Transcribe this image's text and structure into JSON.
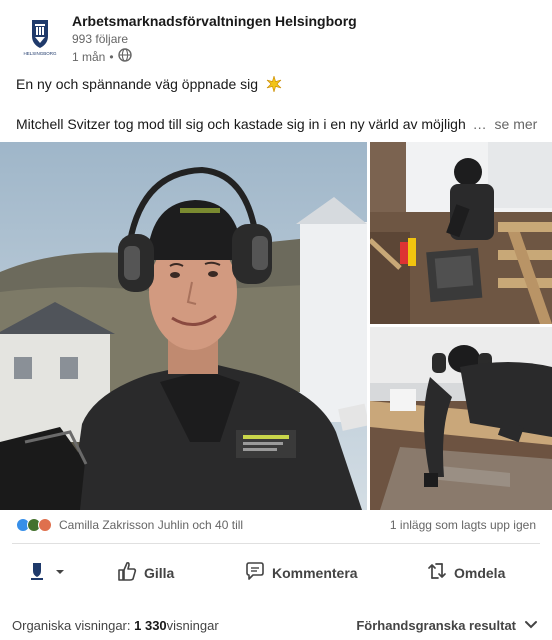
{
  "header": {
    "org_name": "Arbetsmarknadsförvaltningen Helsingborg",
    "followers": "993 följare",
    "time": "1 mån",
    "separator": "•",
    "logo_text": "HELSINGBORG"
  },
  "post": {
    "line1": "En ny och spännande väg öppnade sig",
    "line1_emoji": "sparkle-icon",
    "line2": "Mitchell Svitzer tog mod till sig och kastade sig in i en ny värld av möjligh",
    "ellipsis": "…",
    "see_more": "se mer"
  },
  "images": {
    "main_patch": "Hässlehus Helsingborg AB"
  },
  "reactions": {
    "names": "Camilla Zakrisson Juhlin och 40 till",
    "reposts": "1 inlägg som lagts upp igen"
  },
  "actions": {
    "like": "Gilla",
    "comment": "Kommentera",
    "share": "Omdela"
  },
  "stats": {
    "label": "Organiska visningar: ",
    "count": "1 330",
    "suffix": "visningar",
    "preview": "Förhandsgranska resultat"
  },
  "colors": {
    "text": "#191919",
    "muted": "#666666",
    "like_blue": "#378fe9",
    "celebrate_green": "#44712e",
    "love_red": "#df704d"
  }
}
